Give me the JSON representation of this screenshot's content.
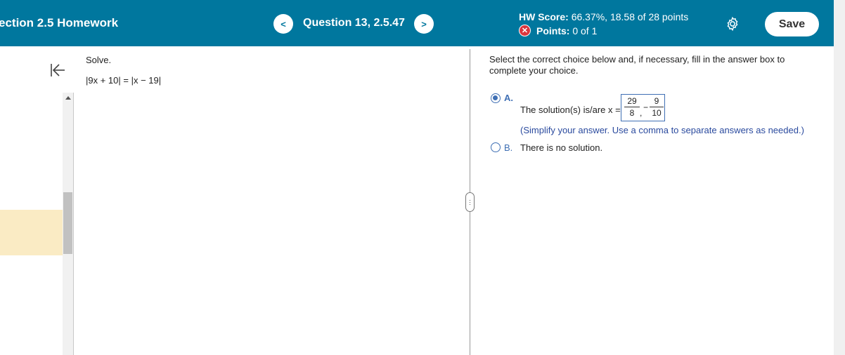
{
  "header": {
    "homework_title": "ection 2.5 Homework",
    "prev_label": "<",
    "question_title": "Question 13, 2.5.47",
    "next_label": ">",
    "hw_score_label": "HW Score:",
    "hw_score_value": "66.37%, 18.58 of 28 points",
    "points_label": "Points:",
    "points_value": "0 of 1",
    "points_status_icon": "x-circle-icon",
    "settings_icon": "gear-icon",
    "save_label": "Save"
  },
  "question": {
    "prompt": "Solve.",
    "equation": "|9x + 10| = |x − 19|"
  },
  "answer_panel": {
    "instructions": "Select the correct choice below and, if necessary, fill in the answer box to complete your choice.",
    "choice_a": {
      "letter": "A.",
      "selected": true,
      "label": "The solution(s) is/are x =",
      "answer": {
        "frac1_num": "29",
        "frac1_den": "8",
        "separator": ",",
        "neg_sign": "−",
        "frac2_num": "9",
        "frac2_den": "10"
      },
      "hint": "(Simplify your answer. Use a comma to separate answers as needed.)"
    },
    "choice_b": {
      "letter": "B.",
      "selected": false,
      "label": "There is no solution."
    }
  },
  "colors": {
    "header_bg": "#00779e",
    "accent_blue": "#3f6fb4",
    "error_red": "#d9363e",
    "highlight_yellow": "#faebc4"
  }
}
